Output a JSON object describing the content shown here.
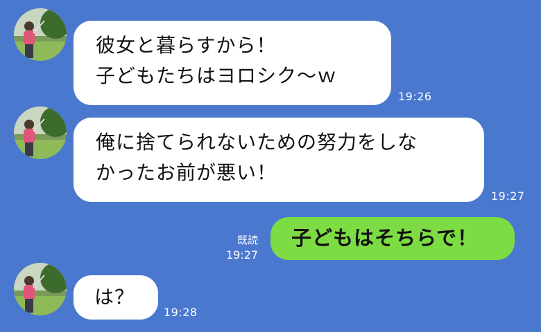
{
  "colors": {
    "background": "#4a78cf",
    "incoming_bubble": "#ffffff",
    "outgoing_bubble": "#7ddc43",
    "timestamp_text": "#ffffff"
  },
  "messages": [
    {
      "sender": "other",
      "avatar": "golfer-avatar",
      "text": "彼女と暮らすから！\n子どもたちはヨロシク〜ｗ",
      "time": "19:26"
    },
    {
      "sender": "other",
      "avatar": "golfer-avatar",
      "text": "俺に捨てられないための努力をしな\nかったお前が悪い！",
      "time": "19:27"
    },
    {
      "sender": "me",
      "text": "子どもはそちらで！",
      "read_label": "既読",
      "time": "19:27"
    },
    {
      "sender": "other",
      "avatar": "golfer-avatar",
      "text": "は？",
      "time": "19:28"
    }
  ]
}
